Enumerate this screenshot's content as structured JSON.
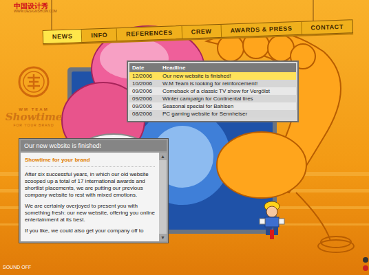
{
  "watermark": {
    "title": "中国设计秀",
    "url": "WWW.DESIGNSHOW.COM"
  },
  "nav": [
    {
      "label": "NEWS",
      "selected": true
    },
    {
      "label": "INFO",
      "selected": false
    },
    {
      "label": "REFERENCES",
      "selected": false
    },
    {
      "label": "CREW",
      "selected": false
    },
    {
      "label": "AWARDS & PRESS",
      "selected": false
    },
    {
      "label": "CONTACT",
      "selected": false
    }
  ],
  "brand": {
    "team": "WM TEAM",
    "name": "Showtime",
    "tagline": "FOR YOUR BRAND"
  },
  "news_table": {
    "columns": [
      "Date",
      "Headline"
    ],
    "rows": [
      {
        "date": "12/2006",
        "headline": "Our new website is finished!",
        "selected": true
      },
      {
        "date": "10/2006",
        "headline": "W.M Team is looking for reinforcement!",
        "selected": false
      },
      {
        "date": "09/2006",
        "headline": "Comeback of a classic TV show for Vergölst",
        "selected": false
      },
      {
        "date": "09/2006",
        "headline": "Winter campaign for Continental tires",
        "selected": false
      },
      {
        "date": "09/2006",
        "headline": "Seasonal special for Bahlsen",
        "selected": false
      },
      {
        "date": "08/2006",
        "headline": "PC gaming website for Sennheiser",
        "selected": false
      }
    ]
  },
  "article": {
    "title": "Our new website is finished!",
    "subtitle": "Showtime for your brand",
    "paragraphs": [
      "After six successful years, in which our old website scooped up a total of 17 international awards and shortlist placements, we are putting our previous company website to rest with mixed emotions.",
      "We are certainly overjoyed to present you with something fresh: our new website, offering you online entertainment at its best.",
      "If you like, we could also get your company off to"
    ],
    "scroll_up": "▲",
    "scroll_down": "▼"
  },
  "sound_toggle": "SOUND OFF"
}
